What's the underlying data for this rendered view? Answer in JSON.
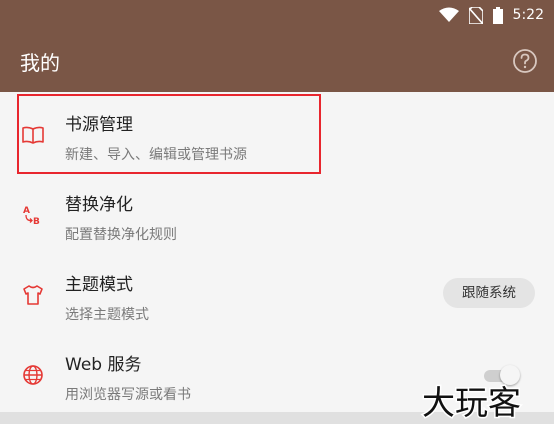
{
  "status_bar": {
    "time": "5:22",
    "icons": [
      "wifi-icon",
      "no-sim-icon",
      "battery-icon"
    ]
  },
  "app_bar": {
    "title": "我的",
    "help_icon": "help-circle-icon"
  },
  "settings": [
    {
      "id": "book-source",
      "title": "书源管理",
      "subtitle": "新建、导入、编辑或管理书源",
      "icon": "book-icon"
    },
    {
      "id": "replace-purify",
      "title": "替换净化",
      "subtitle": "配置替换净化规则",
      "icon": "replace-ab-icon"
    },
    {
      "id": "theme-mode",
      "title": "主题模式",
      "subtitle": "选择主题模式",
      "icon": "shirt-icon",
      "value": "跟随系统"
    },
    {
      "id": "web-service",
      "title": "Web 服务",
      "subtitle": "用浏览器写源或看书",
      "icon": "globe-icon",
      "enabled": false
    }
  ],
  "watermark": {
    "text": "大玩客"
  },
  "colors": {
    "primary": "#7a5646",
    "accent_icon": "#e53935",
    "highlight": "#e8262e"
  }
}
